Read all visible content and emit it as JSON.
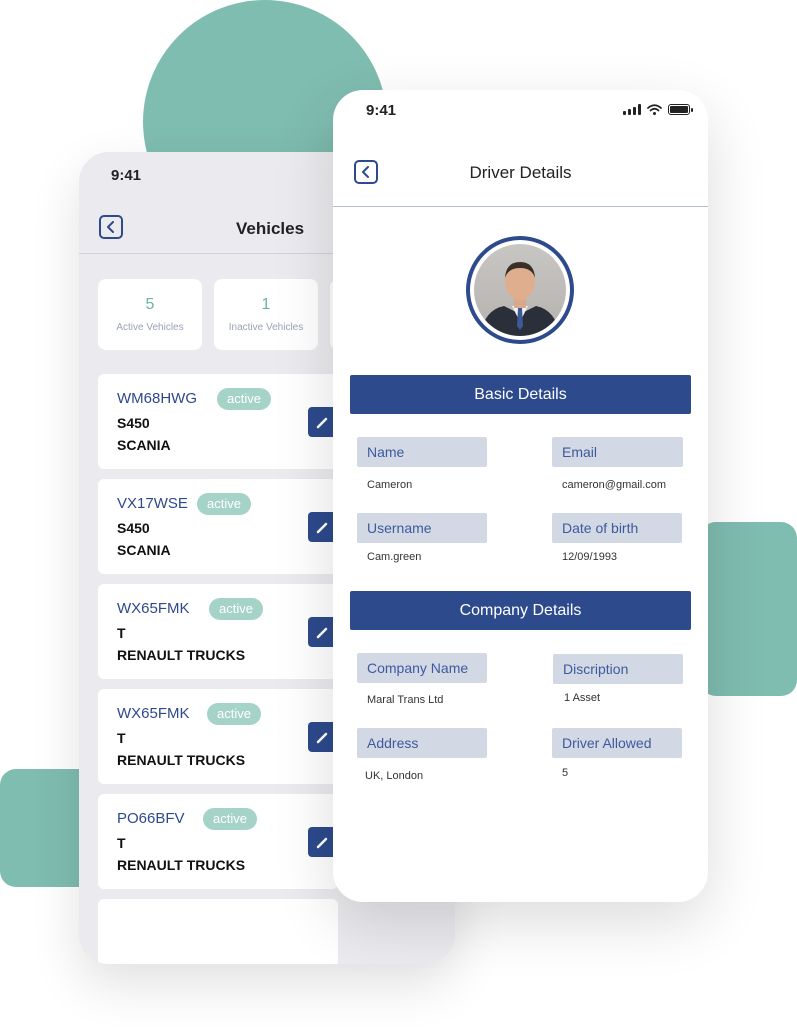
{
  "vehicles_screen": {
    "status_time": "9:41",
    "title": "Vehicles",
    "stats": [
      {
        "value": "5",
        "label": "Active Vehicles"
      },
      {
        "value": "1",
        "label": "Inactive Vehicles"
      }
    ],
    "vehicles": [
      {
        "reg": "WM68HWG",
        "status": "active",
        "model": "S450",
        "make": "SCANIA"
      },
      {
        "reg": "VX17WSE",
        "status": "active",
        "model": "S450",
        "make": "SCANIA"
      },
      {
        "reg": "WX65FMK",
        "status": "active",
        "model": "T",
        "make": "RENAULT TRUCKS"
      },
      {
        "reg": "WX65FMK",
        "status": "active",
        "model": "T",
        "make": "RENAULT TRUCKS"
      },
      {
        "reg": "PO66BFV",
        "status": "active",
        "model": "T",
        "make": "RENAULT TRUCKS"
      }
    ]
  },
  "driver_screen": {
    "status_time": "9:41",
    "title": "Driver Details",
    "basic_section": "Basic Details",
    "company_section": "Company Details",
    "fields": {
      "name": {
        "label": "Name",
        "value": "Cameron"
      },
      "email": {
        "label": "Email",
        "value": "cameron@gmail.com"
      },
      "username": {
        "label": "Username",
        "value": "Cam.green"
      },
      "dob": {
        "label": "Date of birth",
        "value": "12/09/1993"
      },
      "company_name": {
        "label": "Company Name",
        "value": "Maral Trans Ltd"
      },
      "description": {
        "label": "Discription",
        "value": "1 Asset"
      },
      "address": {
        "label": "Address",
        "value": "UK, London"
      },
      "drivers_allowed": {
        "label": "Driver Allowed",
        "value": "5"
      }
    }
  },
  "colors": {
    "primary": "#2d4a8c",
    "accent": "#7fbdb0",
    "badge": "#a6d3c8",
    "field_label_bg": "#d3d8e5"
  }
}
